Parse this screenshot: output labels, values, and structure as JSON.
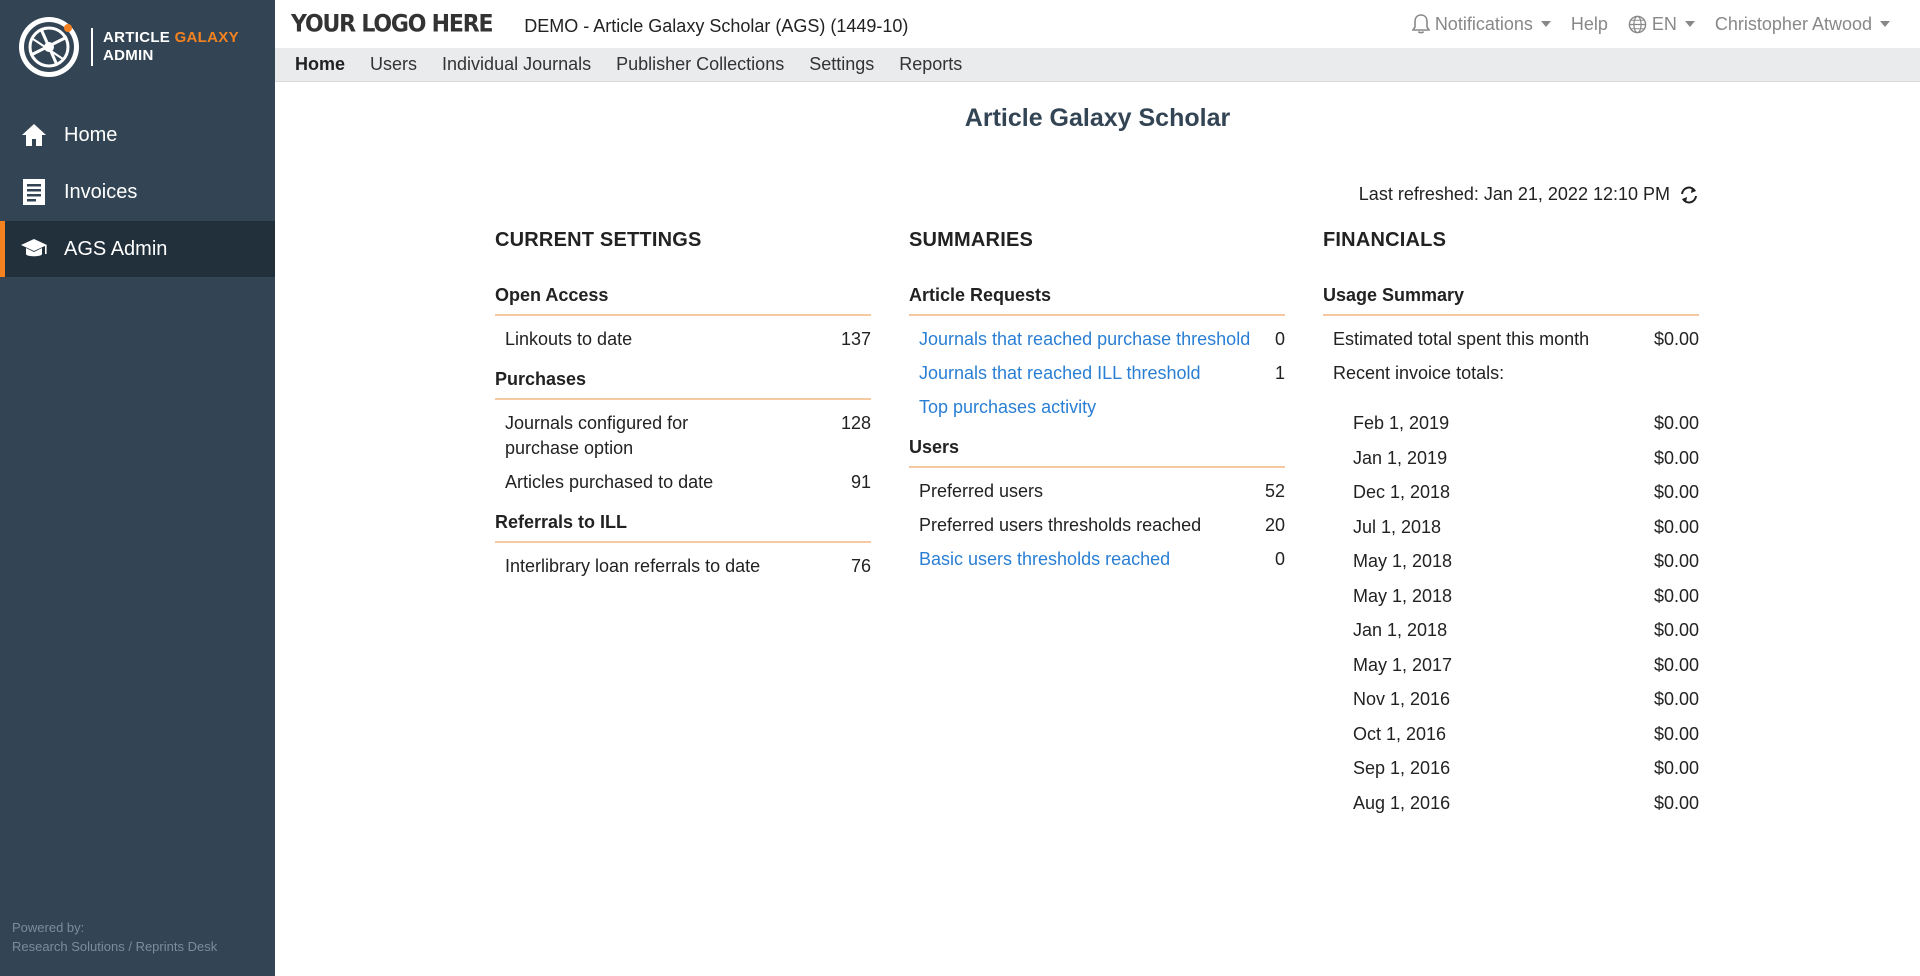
{
  "sidebar": {
    "brand_line1_a": "ARTICLE",
    "brand_line1_b": "GALAXY",
    "brand_line2": "ADMIN",
    "items": [
      {
        "label": "Home",
        "icon": "home-icon"
      },
      {
        "label": "Invoices",
        "icon": "invoice-icon"
      },
      {
        "label": "AGS Admin",
        "icon": "graduation-cap-icon",
        "active": true
      }
    ],
    "powered_by_label": "Powered by:",
    "powered_by_value": "Research Solutions / Reprints Desk"
  },
  "topbar": {
    "logo_text": "YOUR LOGO HERE",
    "app_title": "DEMO - Article Galaxy Scholar (AGS) (1449-10)",
    "notifications": "Notifications",
    "help": "Help",
    "language": "EN",
    "user": "Christopher Atwood"
  },
  "menu": {
    "items": [
      "Home",
      "Users",
      "Individual Journals",
      "Publisher Collections",
      "Settings",
      "Reports"
    ]
  },
  "main": {
    "title": "Article Galaxy Scholar",
    "last_refreshed": "Last refreshed: Jan 21, 2022 12:10 PM"
  },
  "current_settings": {
    "title": "CURRENT SETTINGS",
    "open_access": {
      "title": "Open Access",
      "rows": [
        {
          "label": "Linkouts to date",
          "value": "137"
        }
      ]
    },
    "purchases": {
      "title": "Purchases",
      "rows": [
        {
          "label": "Journals configured for purchase option",
          "value": "128"
        },
        {
          "label": "Articles purchased to date",
          "value": "91"
        }
      ]
    },
    "referrals": {
      "title": "Referrals to ILL",
      "rows": [
        {
          "label": "Interlibrary loan referrals to date",
          "value": "76"
        }
      ]
    }
  },
  "summaries": {
    "title": "SUMMARIES",
    "article_requests": {
      "title": "Article Requests",
      "rows": [
        {
          "label": "Journals that reached purchase threshold",
          "value": "0"
        },
        {
          "label": "Journals that reached ILL threshold",
          "value": "1"
        },
        {
          "label": "Top purchases activity",
          "value": ""
        }
      ]
    },
    "users": {
      "title": "Users",
      "rows": [
        {
          "label": "Preferred users",
          "value": "52"
        },
        {
          "label": "Preferred users thresholds reached",
          "value": "20"
        },
        {
          "label": "Basic users thresholds reached",
          "value": "0"
        }
      ]
    }
  },
  "financials": {
    "title": "FINANCIALS",
    "usage_summary": {
      "title": "Usage Summary",
      "estimated_label": "Estimated total spent this month",
      "estimated_value": "$0.00",
      "recent_label": "Recent invoice totals:",
      "invoices": [
        {
          "date": "Feb 1, 2019",
          "amount": "$0.00"
        },
        {
          "date": "Jan 1, 2019",
          "amount": "$0.00"
        },
        {
          "date": "Dec 1, 2018",
          "amount": "$0.00"
        },
        {
          "date": "Jul 1, 2018",
          "amount": "$0.00"
        },
        {
          "date": "May 1, 2018",
          "amount": "$0.00"
        },
        {
          "date": "May 1, 2018",
          "amount": "$0.00"
        },
        {
          "date": "Jan 1, 2018",
          "amount": "$0.00"
        },
        {
          "date": "May 1, 2017",
          "amount": "$0.00"
        },
        {
          "date": "Nov 1, 2016",
          "amount": "$0.00"
        },
        {
          "date": "Oct 1, 2016",
          "amount": "$0.00"
        },
        {
          "date": "Sep 1, 2016",
          "amount": "$0.00"
        },
        {
          "date": "Aug 1, 2016",
          "amount": "$0.00"
        }
      ]
    }
  },
  "colors": {
    "sidebar": "#334554",
    "accent": "#f58220",
    "link": "#2a7fd4"
  }
}
